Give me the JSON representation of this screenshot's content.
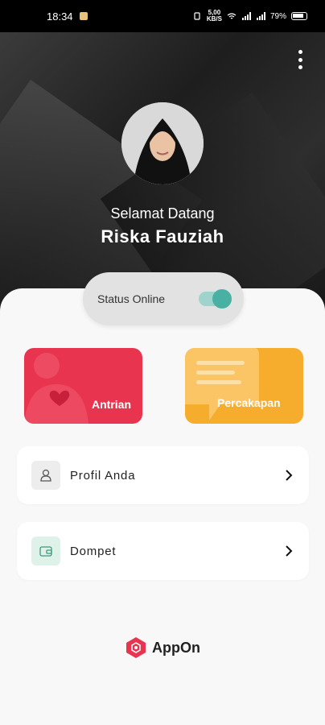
{
  "status_bar": {
    "time": "18:34",
    "net_speed": "5,00\nKB/S",
    "battery": "79%"
  },
  "header": {
    "greeting": "Selamat Datang",
    "name": "Riska Fauziah",
    "menu_icon": "more-vertical-icon"
  },
  "status_toggle": {
    "label": "Status Online",
    "on": true,
    "color": "#49b1a4"
  },
  "cards": [
    {
      "label": "Antrian",
      "color": "#e8344f",
      "icon": "person-heart-icon"
    },
    {
      "label": "Percakapan",
      "color": "#f6ac2c",
      "icon": "chat-bubble-icon"
    }
  ],
  "menu": [
    {
      "label": "Profil Anda",
      "icon": "user-icon"
    },
    {
      "label": "Dompet",
      "icon": "wallet-icon"
    }
  ],
  "brand": {
    "name": "AppOn",
    "color": "#e8344f"
  }
}
